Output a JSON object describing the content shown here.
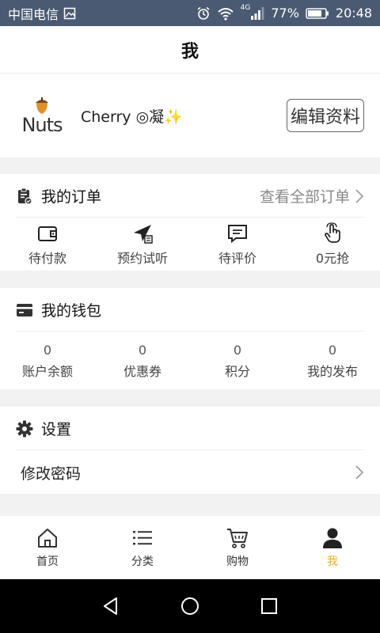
{
  "status_bar": {
    "carrier": "中国电信",
    "network": "4G",
    "battery": "77%",
    "time": "20:48"
  },
  "header": {
    "title": "我"
  },
  "profile": {
    "logo_text": "Nuts",
    "username": "Cherry ◎凝✨",
    "edit_label": "编辑资料"
  },
  "orders": {
    "title": "我的订单",
    "view_all": "查看全部订单",
    "items": [
      {
        "label": "待付款",
        "icon": "wallet-icon"
      },
      {
        "label": "预约试听",
        "icon": "send-icon"
      },
      {
        "label": "待评价",
        "icon": "comment-icon"
      },
      {
        "label": "0元抢",
        "icon": "tap-icon"
      }
    ]
  },
  "wallet": {
    "title": "我的钱包",
    "items": [
      {
        "value": "0",
        "label": "账户余额"
      },
      {
        "value": "0",
        "label": "优惠券"
      },
      {
        "value": "0",
        "label": "积分"
      },
      {
        "value": "0",
        "label": "我的发布"
      }
    ]
  },
  "settings": {
    "title": "设置",
    "items": [
      {
        "label": "修改密码"
      }
    ]
  },
  "tabbar": {
    "items": [
      {
        "label": "首页",
        "icon": "home-icon"
      },
      {
        "label": "分类",
        "icon": "list-icon"
      },
      {
        "label": "购物",
        "icon": "cart-icon"
      },
      {
        "label": "我",
        "icon": "user-icon",
        "active": true
      }
    ]
  },
  "colors": {
    "accent": "#f0a535",
    "status_bar": "#4a5a72"
  }
}
